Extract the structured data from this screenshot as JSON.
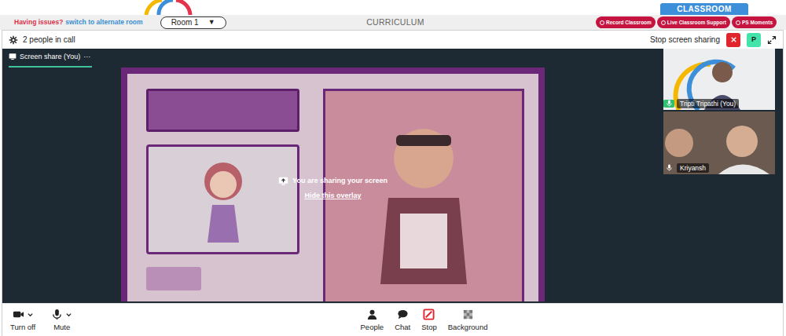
{
  "header": {
    "issue": "Having issues?",
    "switch_link": "switch to alternate room",
    "room": {
      "label": "Room 1",
      "caret": "▼"
    },
    "title": "CURRICULUM",
    "section_tab": "CLASSROOM",
    "actions": [
      {
        "label": "Record Classroom"
      },
      {
        "label": "Live Classroom Support"
      },
      {
        "label": "PS Moments"
      }
    ]
  },
  "call_bar": {
    "people": "2 people in call",
    "stop_sharing": "Stop screen sharing",
    "avatar": "P"
  },
  "stage": {
    "tab": {
      "label": "Screen share (You)",
      "more": "···",
      "selected": true
    },
    "overlay": {
      "message": "You are sharing your screen",
      "hide": "Hide this overlay"
    }
  },
  "participants": [
    {
      "name": "Tripti Tripathi (You)",
      "speaking": true
    },
    {
      "name": "Kriyansh",
      "speaking": false
    }
  ],
  "toolbar": {
    "left": [
      {
        "label": "Turn off",
        "menu": true
      },
      {
        "label": "Mute",
        "menu": true
      }
    ],
    "center": [
      {
        "label": "People",
        "active": false
      },
      {
        "label": "Chat",
        "active": false
      },
      {
        "label": "Stop",
        "active": true
      },
      {
        "label": "Background",
        "active": false
      }
    ]
  }
}
